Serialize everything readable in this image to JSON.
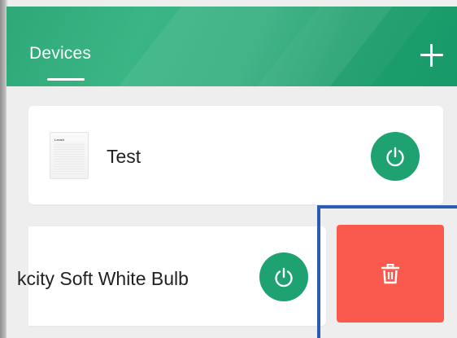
{
  "header": {
    "tab_label": "Devices",
    "add_icon": "plus-icon"
  },
  "devices": [
    {
      "name": "Test",
      "image_brand": "Levoit",
      "power_icon": "power-icon"
    },
    {
      "name": "kcity Soft White Bulb",
      "power_icon": "power-icon"
    }
  ],
  "swipe_action": {
    "icon": "trash-icon"
  },
  "colors": {
    "header_green": "#2fa877",
    "power_green": "#1ea272",
    "delete_red": "#fa5a4d",
    "highlight_blue": "#2a5db0"
  }
}
